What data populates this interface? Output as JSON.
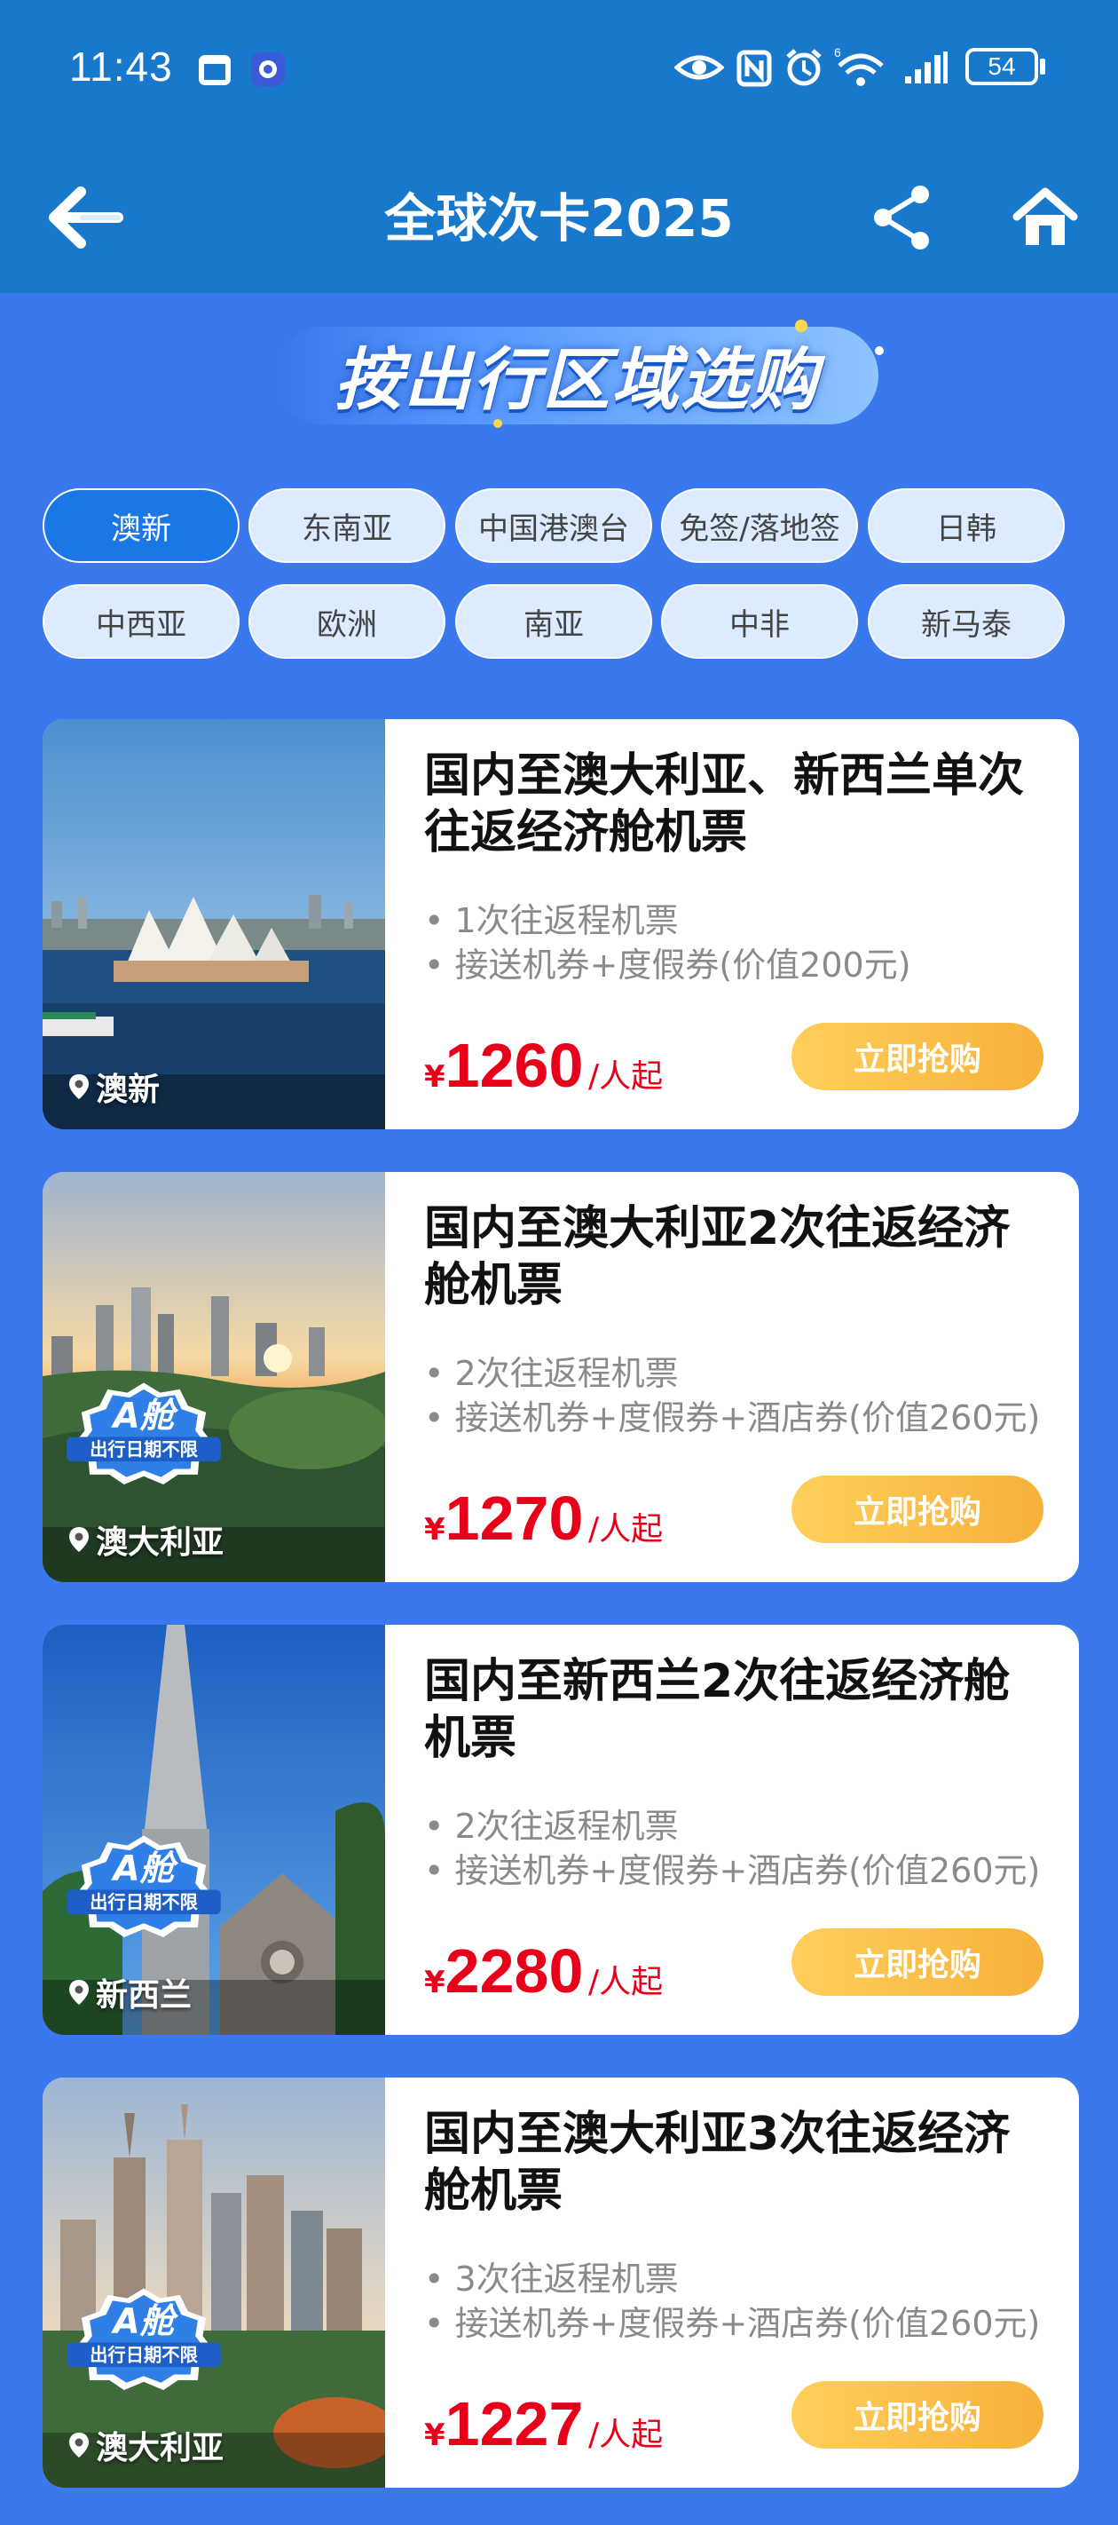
{
  "status_bar": {
    "time": "11:43",
    "battery": "54"
  },
  "nav": {
    "title": "全球次卡2025"
  },
  "section": {
    "title": "按出行区域选购"
  },
  "tabs": [
    "澳新",
    "东南亚",
    "中国港澳台",
    "免签/落地签",
    "日韩",
    "中西亚",
    "欧洲",
    "南亚",
    "中非",
    "新马泰"
  ],
  "active_tab": "澳新",
  "products": [
    {
      "title": "国内至澳大利亚、新西兰单次往返经济舱机票",
      "features": [
        "1次往返程机票",
        "接送机券+度假券(价值200元)"
      ],
      "currency": "¥",
      "price": "1260",
      "unit": "/人起",
      "button": "立即抢购",
      "location": "澳新",
      "badge": null
    },
    {
      "title": "国内至澳大利亚2次往返经济舱机票",
      "features": [
        "2次往返程机票",
        "接送机券+度假券+酒店券(价值260元)"
      ],
      "currency": "¥",
      "price": "1270",
      "unit": "/人起",
      "button": "立即抢购",
      "location": "澳大利亚",
      "badge": {
        "line1": "A舱",
        "line2": "出行日期不限"
      }
    },
    {
      "title": "国内至新西兰2次往返经济舱机票",
      "features": [
        "2次往返程机票",
        "接送机券+度假券+酒店券(价值260元)"
      ],
      "currency": "¥",
      "price": "2280",
      "unit": "/人起",
      "button": "立即抢购",
      "location": "新西兰",
      "badge": {
        "line1": "A舱",
        "line2": "出行日期不限"
      }
    },
    {
      "title": "国内至澳大利亚3次往返经济舱机票",
      "features": [
        "3次往返程机票",
        "接送机券+度假券+酒店券(价值260元)"
      ],
      "currency": "¥",
      "price": "1227",
      "unit": "/人起",
      "button": "立即抢购",
      "location": "澳大利亚",
      "badge": {
        "line1": "A舱",
        "line2": "出行日期不限"
      }
    }
  ],
  "colors": {
    "header": "#1778cc",
    "page_bg": "#3a78ee",
    "price": "#e8001b",
    "button": "#f6b13b",
    "active_tab": "#1a78e6"
  },
  "icons": {
    "back": "back-arrow-icon",
    "share": "share-icon",
    "home": "home-icon"
  }
}
